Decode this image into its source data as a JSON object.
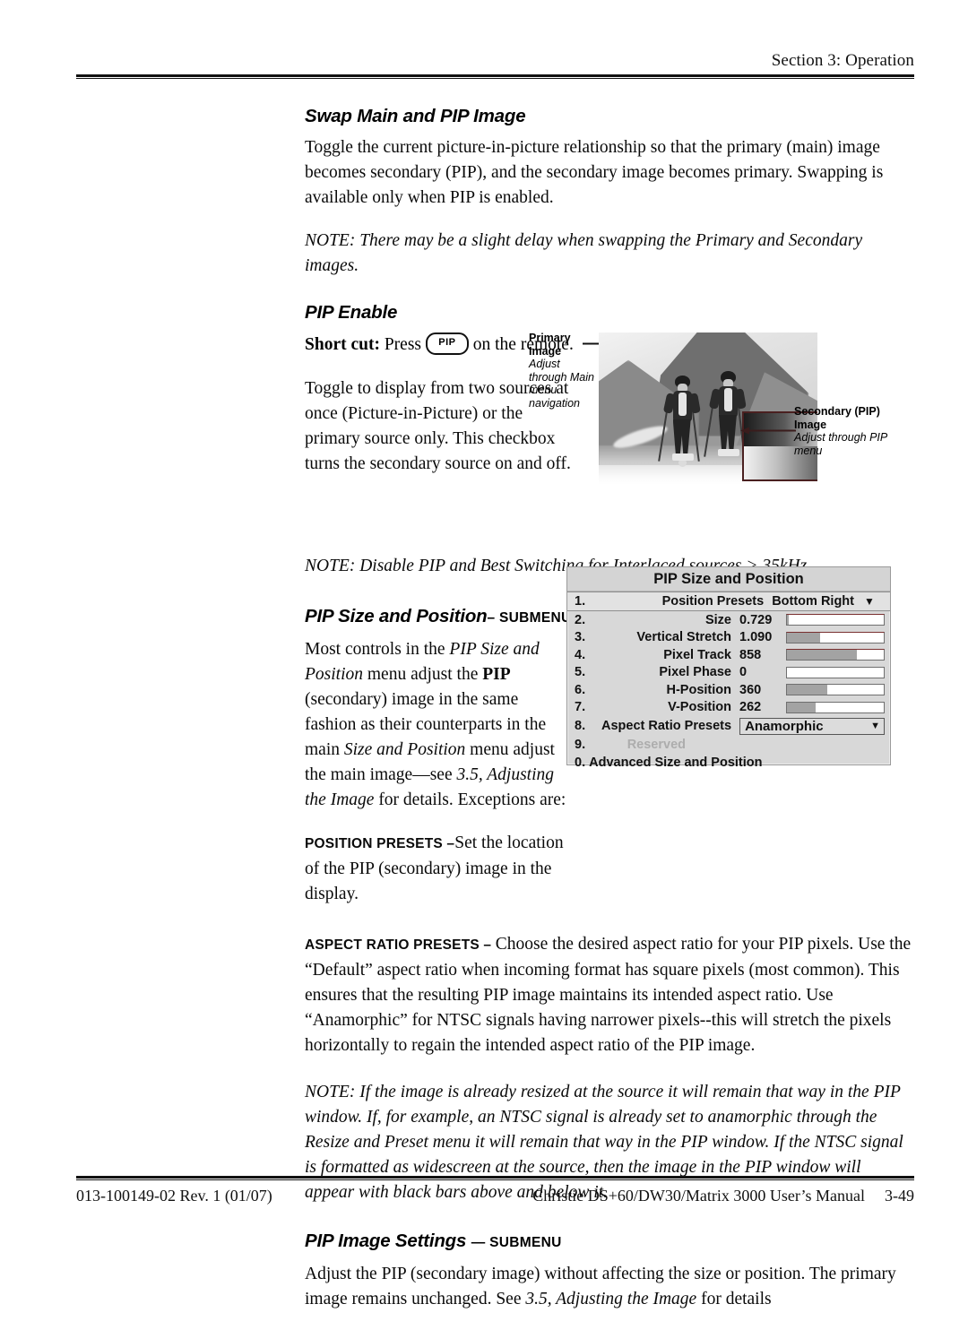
{
  "header": {
    "section_label": "Section 3: Operation"
  },
  "sections": {
    "swap": {
      "heading": "Swap Main and PIP Image",
      "paragraph": "Toggle the current picture-in-picture relationship so that the primary (main) image becomes secondary (PIP), and the secondary image becomes primary. Swapping is available only when PIP is enabled.",
      "note": "NOTE: There may be a slight delay when swapping the Primary and Secondary images."
    },
    "pip_enable": {
      "heading": "PIP Enable",
      "shortcut_prefix": "Short cut:",
      "shortcut_press": "Press",
      "shortcut_key": "PIP",
      "shortcut_suffix": "on the remote.",
      "paragraph": "Toggle to display from two sources at once (Picture-in-Picture) or the primary source only. This checkbox turns the secondary source on and off.",
      "note": "NOTE: Disable PIP and Best Switching for Interlaced sources > 35kHz."
    },
    "pip_size_position": {
      "heading": "PIP Size and Position",
      "heading_suffix": "– SUBMENU",
      "paragraph_1a": "Most controls in the ",
      "paragraph_1b": "PIP Size and Position",
      "paragraph_1c": " menu adjust the ",
      "paragraph_1d": "PIP",
      "paragraph_1e": " (secondary) image in the same fashion as their counterparts in the main ",
      "paragraph_1f": "Size and Position",
      "paragraph_1g": " menu adjust the main image—see ",
      "paragraph_1h": "3.5, Adjusting the Image",
      "paragraph_1i": " for details. Exceptions are:",
      "position_presets_lead": "POSITION PRESETS –",
      "position_presets_body": "Set the location of the PIP (secondary) image in the display.",
      "aspect_lead": "ASPECT RATIO PRESETS – ",
      "aspect_body": "Choose the desired aspect ratio for your PIP pixels. Use the “Default” aspect ratio when incoming format has square pixels (most common). This ensures that the resulting PIP image maintains its intended aspect ratio. Use “Anamorphic” for NTSC signals having narrower pixels--this will stretch the pixels horizontally to regain the intended aspect ratio of the PIP image.",
      "note": "NOTE: If the image is already resized at the source it will remain that way in the PIP window. If, for example, an NTSC signal is already set to anamorphic through the Resize and Preset menu it will remain that way in the PIP window. If the NTSC signal is formatted as widescreen at the source, then the image in the PIP window will appear with black bars above and below it."
    },
    "pip_image_settings": {
      "heading": "PIP Image Settings",
      "heading_suffix": "— SUBMENU",
      "paragraph_a": "Adjust the PIP (secondary image) without affecting the size or position. The primary image remains unchanged. See ",
      "paragraph_b": "3.5, Adjusting the Image",
      "paragraph_c": " for details"
    }
  },
  "figure": {
    "primary_label_title": "Primary Image",
    "primary_label_sub": "Adjust through Main menu navigation",
    "secondary_label_title": "Secondary (PIP) Image",
    "secondary_label_sub": "Adjust through PIP menu",
    "arrow_icon_primary": "arrow-right-icon",
    "arrow_icon_secondary": "arrow-left-icon"
  },
  "osd_menu": {
    "title": "PIP Size and Position",
    "rows": [
      {
        "num": "1.",
        "label": "Position Presets",
        "value": "Bottom Right",
        "control": "dropdown",
        "caret": "▼"
      },
      {
        "num": "2.",
        "label": "Size",
        "value": "0.729",
        "control": "slider",
        "fill": 2
      },
      {
        "num": "3.",
        "label": "Vertical Stretch",
        "value": "1.090",
        "control": "slider",
        "fill": 34
      },
      {
        "num": "4.",
        "label": "Pixel Track",
        "value": "858",
        "control": "slider",
        "fill": 72
      },
      {
        "num": "5.",
        "label": "Pixel Phase",
        "value": "0",
        "control": "slider",
        "fill": 0
      },
      {
        "num": "6.",
        "label": "H-Position",
        "value": "360",
        "control": "slider",
        "fill": 42
      },
      {
        "num": "7.",
        "label": "V-Position",
        "value": "262",
        "control": "slider",
        "fill": 30
      },
      {
        "num": "8.",
        "label": "Aspect Ratio Presets",
        "value": "Anamorphic",
        "control": "select",
        "caret": "▼"
      },
      {
        "num": "9.",
        "label": "Reserved",
        "value": "",
        "control": "none"
      },
      {
        "num": "0.",
        "label": "Advanced Size and Position",
        "value": "",
        "control": "none"
      }
    ]
  },
  "footer": {
    "doc_id": "013-100149-02 Rev. 1 (01/07)",
    "manual_title": "Christie DS+60/DW30/Matrix 3000 User’s Manual",
    "page_number": "3-49"
  }
}
